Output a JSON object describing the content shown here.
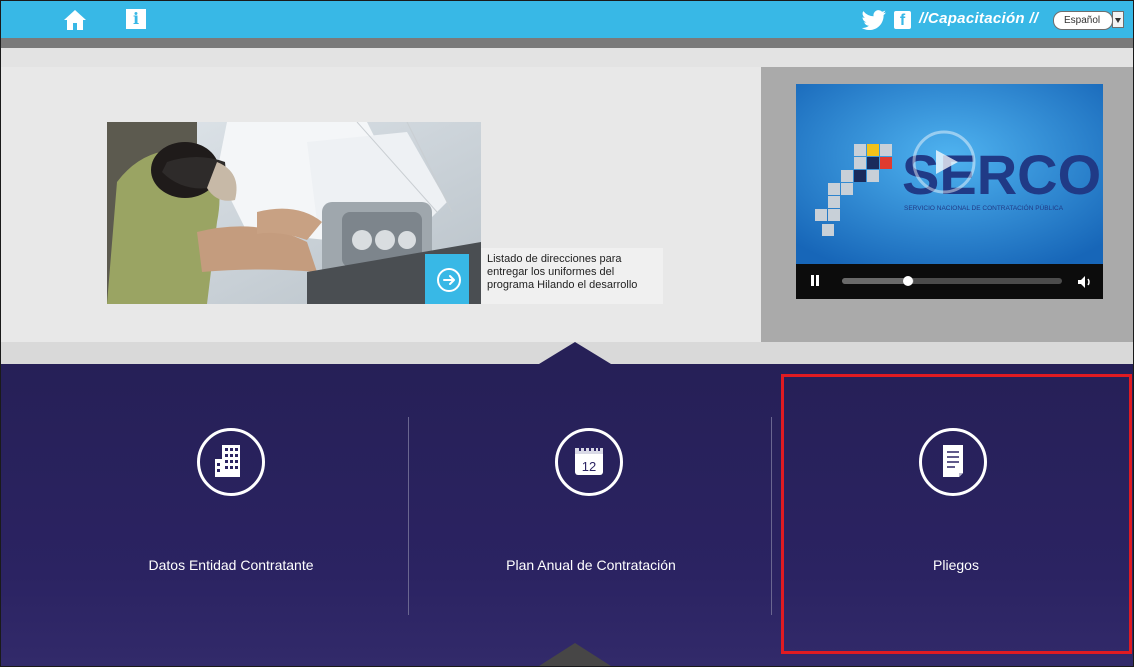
{
  "topbar": {
    "section_label": "//Capacitación //",
    "language": {
      "selected": "Español"
    },
    "accent": "#38b8e6"
  },
  "banner": {
    "caption": "Listado de direcciones para entregar los uniformes del programa Hilando el desarrollo"
  },
  "video": {
    "logo_text": "SERCOP",
    "logo_subtitle": "SERVICIO NACIONAL DE CONTRATACIÓN PÚBLICA",
    "progress": 0.3
  },
  "tiles": [
    {
      "label": "Datos Entidad Contratante",
      "icon": "building-icon"
    },
    {
      "label": "Plan Anual de Contratación",
      "icon": "calendar-icon",
      "icon_text": "12"
    },
    {
      "label": "Pliegos",
      "icon": "document-icon"
    }
  ],
  "highlight_color": "#e01b22"
}
